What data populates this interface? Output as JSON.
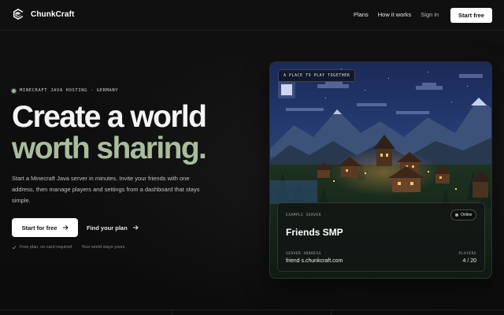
{
  "nav": {
    "brand": "ChunkCraft",
    "links": [
      "Plans",
      "How it works",
      "Sign in"
    ],
    "cta": "Start free"
  },
  "hero": {
    "eyebrow": "MINECRAFT JAVA HOSTING · GERMANY",
    "headline_1": "Create a world",
    "headline_2": "worth sharing.",
    "lede": "Start a Minecraft Java server in minutes. Invite your friends with one address, then manage players and settings from a dashboard that stays simple.",
    "primary_cta": "Start for free",
    "secondary_cta": "Find your plan",
    "notes": [
      "Free plan, no card required",
      "Your world stays yours"
    ]
  },
  "card": {
    "tag": "A PLACE TO PLAY TOGETHER",
    "panel_label": "EXAMPLE SERVER",
    "status": "Online",
    "server_name": "Friends SMP",
    "address_label": "SERVER ADDRESS",
    "address": "friend s.chunkcraft.com",
    "players_label": "PLAYERS",
    "players": "4 / 20"
  },
  "icons": {
    "logo": "chunkcraft-logo-icon",
    "arrow": "arrow-right-icon",
    "check": "check-icon",
    "status": "status-dot-icon"
  },
  "colors": {
    "accent": "#a9bd9d",
    "background": "#0f0f0f",
    "online": "#8fb68a"
  }
}
